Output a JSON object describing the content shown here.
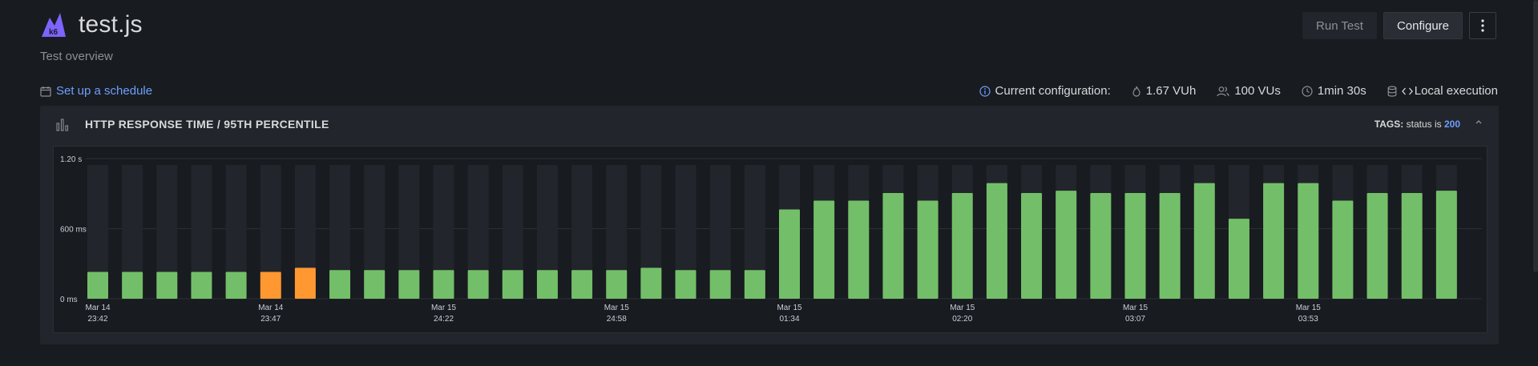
{
  "header": {
    "title": "test.js",
    "subtitle": "Test overview",
    "logo_text": "k6"
  },
  "actions": {
    "run_label": "Run Test",
    "configure_label": "Configure",
    "more_label": "⋮"
  },
  "schedule": {
    "label": "Set up a schedule"
  },
  "configuration": {
    "label": "Current configuration:",
    "vuh": "1.67 VUh",
    "vus": "100 VUs",
    "duration": "1min 30s",
    "execution": "Local execution"
  },
  "panel": {
    "title": "HTTP RESPONSE TIME / 95TH PERCENTILE",
    "tags_label": "TAGS:",
    "tags_key": "status is",
    "tags_value": "200"
  },
  "colors": {
    "ok": "#73bf69",
    "warn": "#ff9830",
    "background_bar": "#22252b",
    "link": "#6e9fff"
  },
  "chart_data": {
    "type": "bar",
    "ylabel": "",
    "ylim": [
      0,
      1200
    ],
    "yticks": [
      {
        "value": 0,
        "label": "0 ms"
      },
      {
        "value": 600,
        "label": "600 ms"
      },
      {
        "value": 1200,
        "label": "1.20 s"
      }
    ],
    "values": [
      230,
      230,
      230,
      230,
      230,
      230,
      265,
      245,
      245,
      245,
      245,
      245,
      245,
      245,
      245,
      245,
      265,
      245,
      245,
      245,
      765,
      840,
      840,
      905,
      840,
      905,
      990,
      905,
      925,
      905,
      905,
      905,
      990,
      685,
      990,
      990,
      840,
      905,
      905,
      925
    ],
    "status": [
      "ok",
      "ok",
      "ok",
      "ok",
      "ok",
      "warn",
      "warn",
      "ok",
      "ok",
      "ok",
      "ok",
      "ok",
      "ok",
      "ok",
      "ok",
      "ok",
      "ok",
      "ok",
      "ok",
      "ok",
      "ok",
      "ok",
      "ok",
      "ok",
      "ok",
      "ok",
      "ok",
      "ok",
      "ok",
      "ok",
      "ok",
      "ok",
      "ok",
      "ok",
      "ok",
      "ok",
      "ok",
      "ok",
      "ok",
      "ok"
    ],
    "x_labels": [
      {
        "index": 0,
        "date": "Mar 14",
        "time": "23:42"
      },
      {
        "index": 5,
        "date": "Mar 14",
        "time": "23:47"
      },
      {
        "index": 10,
        "date": "Mar 15",
        "time": "24:22"
      },
      {
        "index": 15,
        "date": "Mar 15",
        "time": "24:58"
      },
      {
        "index": 20,
        "date": "Mar 15",
        "time": "01:34"
      },
      {
        "index": 25,
        "date": "Mar 15",
        "time": "02:20"
      },
      {
        "index": 30,
        "date": "Mar 15",
        "time": "03:07"
      },
      {
        "index": 35,
        "date": "Mar 15",
        "time": "03:53"
      }
    ],
    "grid": true
  }
}
